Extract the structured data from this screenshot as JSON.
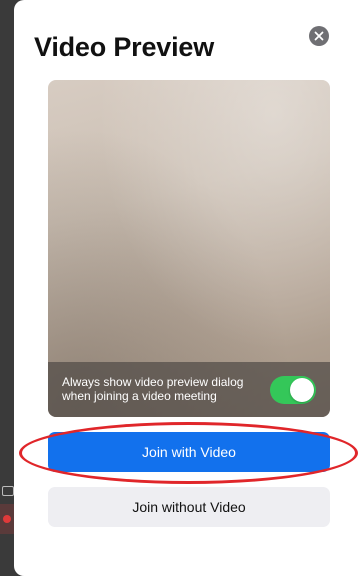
{
  "dialog": {
    "title": "Video Preview",
    "close_icon": "close-icon"
  },
  "preview": {
    "toggle_label": "Always show video preview dialog when joining a video meeting",
    "toggle_on": true
  },
  "buttons": {
    "join_with_video": "Join with Video",
    "join_without_video": "Join without Video"
  },
  "colors": {
    "primary": "#1271ed",
    "toggle_on": "#34c759",
    "annotation": "#e0262a"
  }
}
